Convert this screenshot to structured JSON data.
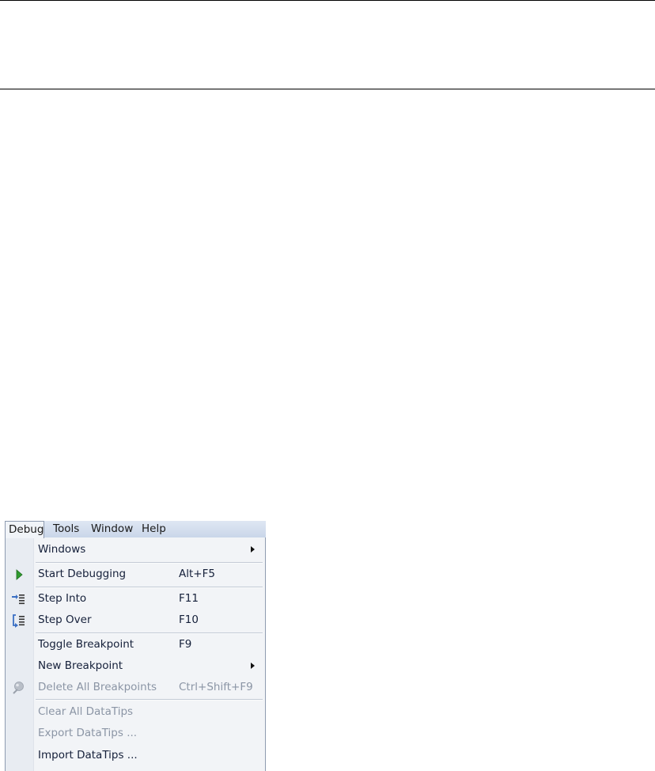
{
  "menubar": {
    "items": [
      "Debug",
      "Tools",
      "Window",
      "Help"
    ]
  },
  "menu": {
    "windows": {
      "label": "Windows"
    },
    "start_debugging": {
      "label": "Start Debugging",
      "shortcut": "Alt+F5"
    },
    "step_into": {
      "label": "Step Into",
      "shortcut": "F11"
    },
    "step_over": {
      "label": "Step Over",
      "shortcut": "F10"
    },
    "toggle_breakpoint": {
      "label": "Toggle Breakpoint",
      "shortcut": "F9"
    },
    "new_breakpoint": {
      "label": "New Breakpoint"
    },
    "delete_all_breakpoints": {
      "label": "Delete All Breakpoints",
      "shortcut": "Ctrl+Shift+F9"
    },
    "clear_all_datatips": {
      "label": "Clear All DataTips"
    },
    "export_datatips": {
      "label": "Export DataTips ..."
    },
    "import_datatips": {
      "label": "Import DataTips ..."
    }
  },
  "colors": {
    "play_green": "#2f9b2f",
    "step_blue": "#3a6fc4",
    "disabled_text": "#8b95a5"
  }
}
